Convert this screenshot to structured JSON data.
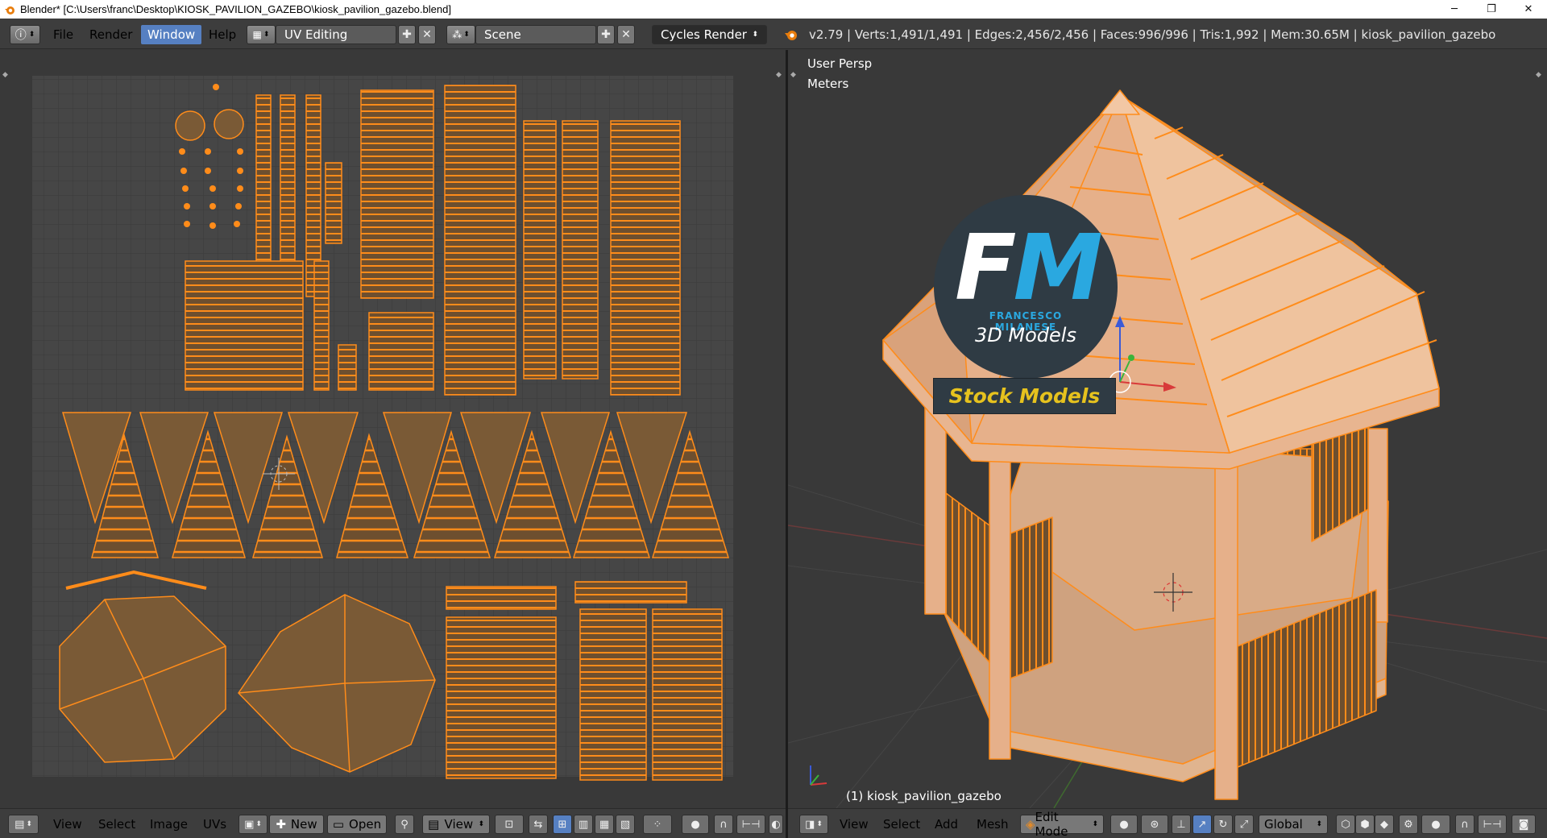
{
  "window": {
    "title": "Blender* [C:\\Users\\franc\\Desktop\\KIOSK_PAVILION_GAZEBO\\kiosk_pavilion_gazebo.blend]",
    "minimize": "─",
    "maximize": "❐",
    "close": "✕"
  },
  "info_header": {
    "menus": [
      "File",
      "Render",
      "Window",
      "Help"
    ],
    "active_menu": "Window",
    "screen_layout": "UV Editing",
    "scene": "Scene",
    "render_engine": "Cycles Render",
    "stats": "v2.79 | Verts:1,491/1,491 | Edges:2,456/2,456 | Faces:996/996 | Tris:1,992 | Mem:30.65M | kiosk_pavilion_gazebo"
  },
  "uv_editor": {
    "menus": [
      "View",
      "Select",
      "Image",
      "UVs"
    ],
    "new_label": "New",
    "open_label": "Open",
    "view_label": "View"
  },
  "viewport": {
    "view_label": "User Persp",
    "units_label": "Meters",
    "object_label": "(1) kiosk_pavilion_gazebo",
    "menus": [
      "View",
      "Select",
      "Add",
      "Mesh"
    ],
    "mode": "Edit Mode",
    "orientation": "Global"
  },
  "logo": {
    "letters_f": "F",
    "letters_m": "M",
    "name": "FRANCESCO MILANESE",
    "subtitle": "3D Models",
    "banner": "Stock Models",
    "colors": {
      "circle": "#2f3b44",
      "accent": "#2aa8e0",
      "banner_text": "#e6c21e"
    }
  },
  "colors": {
    "uv_orange": "#ff8c1a",
    "uv_face_fill": "#7a5a36",
    "mesh_face": "#e6b08a",
    "header_bg": "#3d3d3d",
    "active_blue": "#5680c2"
  }
}
